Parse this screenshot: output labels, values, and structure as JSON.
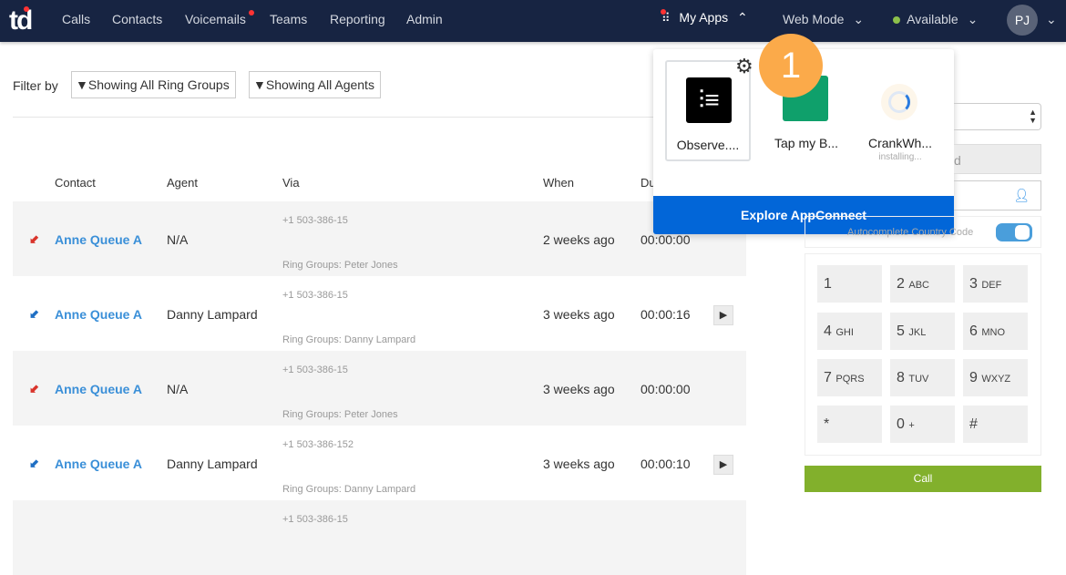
{
  "nav": {
    "logo": "td",
    "items": [
      "Calls",
      "Contacts",
      "Voicemails",
      "Teams",
      "Reporting",
      "Admin"
    ],
    "my_apps": "My Apps",
    "web_mode": "Web Mode",
    "status": "Available",
    "avatar": "PJ"
  },
  "filter": {
    "label": "Filter by",
    "ring_groups": "Showing All Ring Groups",
    "agents": "Showing All Agents"
  },
  "table": {
    "headers": [
      "Contact",
      "Agent",
      "Via",
      "When",
      "Du"
    ],
    "rows": [
      {
        "direction": "inbound-missed",
        "contact": "Anne Queue A",
        "agent": "N/A",
        "number": "+1 503-386-15",
        "ring_group": "Ring Groups: Peter Jones",
        "when": "2 weeks ago",
        "duration": "00:00:00",
        "play": false
      },
      {
        "direction": "inbound",
        "contact": "Anne Queue A",
        "agent": "Danny Lampard",
        "number": "+1 503-386-15",
        "ring_group": "Ring Groups: Danny Lampard",
        "when": "3 weeks ago",
        "duration": "00:00:16",
        "play": true
      },
      {
        "direction": "inbound-missed",
        "contact": "Anne Queue A",
        "agent": "N/A",
        "number": "+1 503-386-15",
        "ring_group": "Ring Groups: Peter Jones",
        "when": "3 weeks ago",
        "duration": "00:00:00",
        "play": false
      },
      {
        "direction": "inbound",
        "contact": "Anne Queue A",
        "agent": "Danny Lampard",
        "number": "+1 503-386-152",
        "ring_group": "Ring Groups: Danny Lampard",
        "when": "3 weeks ago",
        "duration": "00:00:10",
        "play": true
      },
      {
        "number": "+1 503-386-15"
      }
    ]
  },
  "apps_popup": {
    "apps": [
      {
        "name": "Observe....",
        "status": ""
      },
      {
        "name": "Tap my B...",
        "status": ""
      },
      {
        "name": "CrankWh...",
        "status": "installing..."
      }
    ],
    "explore": "Explore AppConnect",
    "step_badge": "1"
  },
  "dialer": {
    "partial_field": "d",
    "autocomplete_label": "Autocomplete Country Code",
    "autocomplete_on": true,
    "keys": [
      [
        "1",
        ""
      ],
      [
        "2",
        "ABC"
      ],
      [
        "3",
        "DEF"
      ],
      [
        "4",
        "GHI"
      ],
      [
        "5",
        "JKL"
      ],
      [
        "6",
        "MNO"
      ],
      [
        "7",
        "PQRS"
      ],
      [
        "8",
        "TUV"
      ],
      [
        "9",
        "WXYZ"
      ],
      [
        "*",
        ""
      ],
      [
        "0",
        "+"
      ],
      [
        "#",
        ""
      ]
    ],
    "call": "Call"
  },
  "colors": {
    "nav": "#172442",
    "link": "#3a8fd8",
    "explore": "#0266d8",
    "call": "#82b02c",
    "badge": "#fbaa4a",
    "missed": "#d9342b",
    "inbound": "#1f6fc4"
  }
}
